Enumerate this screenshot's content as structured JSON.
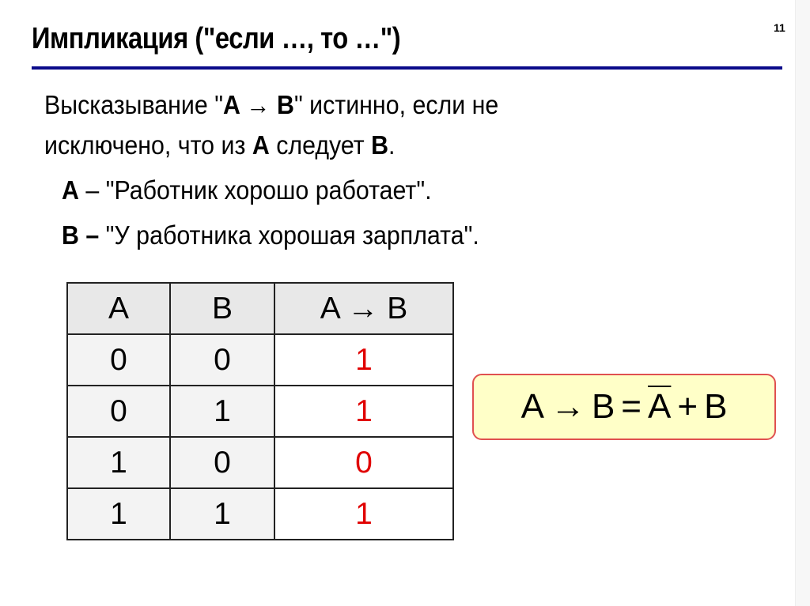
{
  "slide": {
    "title": "Импликация (\"если …, то …\")",
    "number": "11",
    "colors": {
      "rule": "#0b0b8a",
      "result_value": "#e00000",
      "formula_bg": "#ffffc8",
      "formula_border": "#e05050"
    }
  },
  "body": {
    "line1_prefix": "Высказывание \"",
    "line1_expr": "A → B",
    "line1_suffix": "\" истинно, если не",
    "line2_prefix": "исключено, что из ",
    "line2_a": "A",
    "line2_mid": " следует ",
    "line2_b": "B",
    "line2_end": ".",
    "def_a_label": "A",
    "def_a_text": " – \"Работник хорошо работает\".",
    "def_b_label": "B –",
    "def_b_text": " \"У работника хорошая зарплата\"."
  },
  "table": {
    "headers": [
      "A",
      "B",
      "A → B"
    ],
    "rows": [
      [
        "0",
        "0",
        "1"
      ],
      [
        "0",
        "1",
        "1"
      ],
      [
        "1",
        "0",
        "0"
      ],
      [
        "1",
        "1",
        "1"
      ]
    ]
  },
  "formula": {
    "lhs_a": "A",
    "arrow": "→",
    "lhs_b": "B",
    "equals": "=",
    "rhs_not_a": "A",
    "plus": "+",
    "rhs_b": "B"
  }
}
